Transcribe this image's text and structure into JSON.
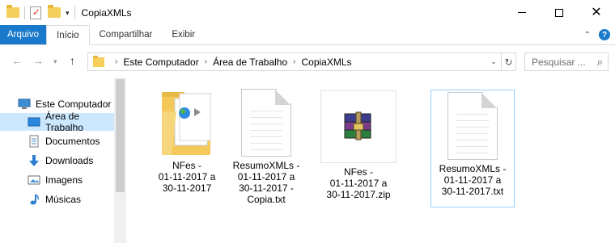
{
  "window": {
    "title": "CopiaXMLs"
  },
  "ribbon": {
    "tabs": [
      "Arquivo",
      "Início",
      "Compartilhar",
      "Exibir"
    ],
    "active_tab": "Início",
    "file_color": "#1979ca"
  },
  "navigation": {
    "back_icon": "arrow-left-icon",
    "forward_icon": "arrow-right-icon",
    "recent_icon": "chevron-down-icon",
    "up_icon": "arrow-up-icon"
  },
  "address": {
    "breadcrumbs": [
      "Este Computador",
      "Área de Trabalho",
      "CopiaXMLs"
    ]
  },
  "search": {
    "placeholder": "Pesquisar ..."
  },
  "sidebar": {
    "items": [
      {
        "label": "Este Computador",
        "icon": "computer-icon",
        "selected": false
      },
      {
        "label": "Área de Trabalho",
        "icon": "desktop-icon",
        "selected": true
      },
      {
        "label": "Documentos",
        "icon": "documents-icon",
        "selected": false
      },
      {
        "label": "Downloads",
        "icon": "download-arrow-icon",
        "selected": false
      },
      {
        "label": "Imagens",
        "icon": "pictures-icon",
        "selected": false
      },
      {
        "label": "Músicas",
        "icon": "music-note-icon",
        "selected": false
      }
    ],
    "selected_color": "#cce8ff"
  },
  "files": [
    {
      "name": "NFes -\n01-11-2017 a\n30-11-2017",
      "type": "folder",
      "icon": "folder-icon"
    },
    {
      "name": "ResumoXMLs -\n01-11-2017 a\n30-11-2017 -\nCopia.txt",
      "type": "txt",
      "icon": "text-file-icon"
    },
    {
      "name": "NFes -\n01-11-2017 a\n30-11-2017.zip",
      "type": "zip",
      "icon": "winrar-archive-icon"
    },
    {
      "name": "ResumoXMLs -\n01-11-2017 a\n30-11-2017.txt",
      "type": "txt",
      "icon": "text-file-icon",
      "selected": true
    }
  ]
}
